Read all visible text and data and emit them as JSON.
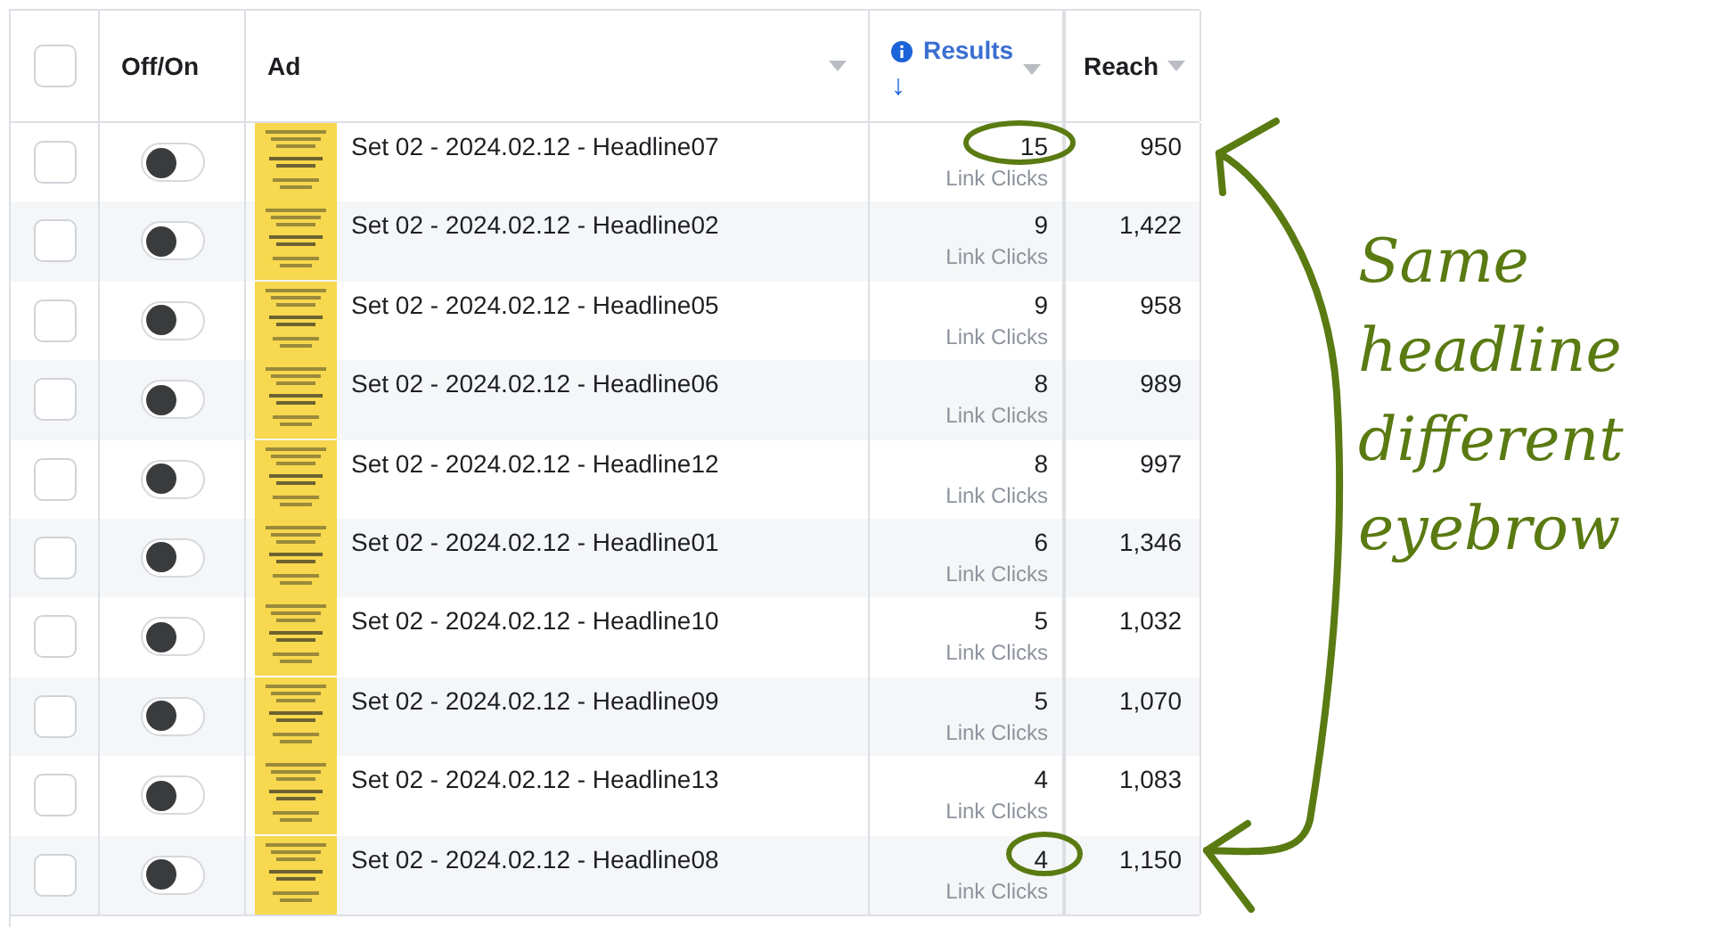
{
  "table": {
    "all_checked": false,
    "columns": [
      {
        "kind": "select"
      },
      {
        "kind": "text",
        "label": "Off/On"
      },
      {
        "kind": "text",
        "label": "Ad",
        "caret": true
      },
      {
        "kind": "metric",
        "label": "Results",
        "sort": "↓",
        "caret": true
      },
      {
        "kind": "text",
        "label": "Reach",
        "caret": true
      }
    ],
    "rows": [
      {
        "checked": false,
        "on": false,
        "ad": "Set 02 - 2024.02.12 - Headline07",
        "results": "15",
        "result_type": "Link Clicks",
        "reach": "950"
      },
      {
        "checked": false,
        "on": false,
        "ad": "Set 02 - 2024.02.12 - Headline02",
        "results": "9",
        "result_type": "Link Clicks",
        "reach": "1,422"
      },
      {
        "checked": false,
        "on": false,
        "ad": "Set 02 - 2024.02.12 - Headline05",
        "results": "9",
        "result_type": "Link Clicks",
        "reach": "958"
      },
      {
        "checked": false,
        "on": false,
        "ad": "Set 02 - 2024.02.12 - Headline06",
        "results": "8",
        "result_type": "Link Clicks",
        "reach": "989"
      },
      {
        "checked": false,
        "on": false,
        "ad": "Set 02 - 2024.02.12 - Headline12",
        "results": "8",
        "result_type": "Link Clicks",
        "reach": "997"
      },
      {
        "checked": false,
        "on": false,
        "ad": "Set 02 - 2024.02.12 - Headline01",
        "results": "6",
        "result_type": "Link Clicks",
        "reach": "1,346"
      },
      {
        "checked": false,
        "on": false,
        "ad": "Set 02 - 2024.02.12 - Headline10",
        "results": "5",
        "result_type": "Link Clicks",
        "reach": "1,032"
      },
      {
        "checked": false,
        "on": false,
        "ad": "Set 02 - 2024.02.12 - Headline09",
        "results": "5",
        "result_type": "Link Clicks",
        "reach": "1,070"
      },
      {
        "checked": false,
        "on": false,
        "ad": "Set 02 - 2024.02.12 - Headline13",
        "results": "4",
        "result_type": "Link Clicks",
        "reach": "1,083"
      },
      {
        "checked": false,
        "on": false,
        "ad": "Set 02 - 2024.02.12 - Headline08",
        "results": "4",
        "result_type": "Link Clicks",
        "reach": "1,150"
      }
    ]
  },
  "annotation": {
    "lines": [
      "Same",
      "headline",
      "different",
      "eyebrow"
    ]
  }
}
